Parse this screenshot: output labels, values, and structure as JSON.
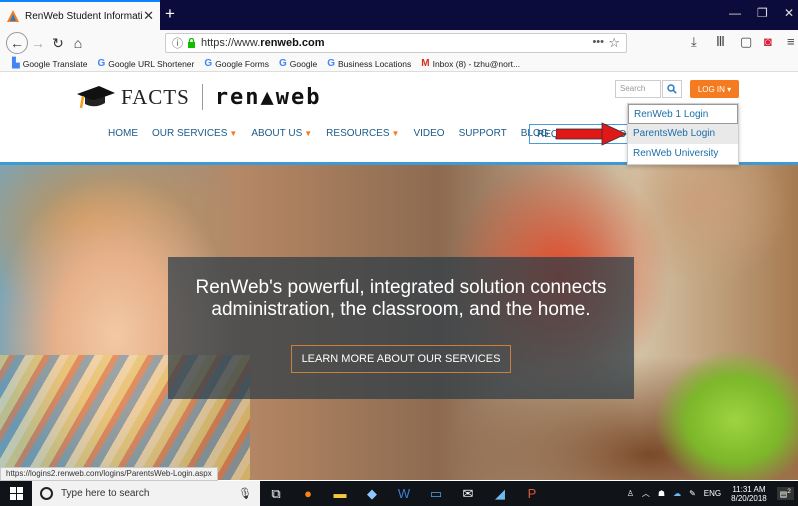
{
  "browser": {
    "tab_title": "RenWeb Student Information S",
    "tab_close": "✕",
    "new_tab": "+",
    "url_prefix": "https://www.",
    "url_domain": "renweb.com",
    "url_more": "•••",
    "window_controls": [
      "—",
      "❐",
      "✕"
    ]
  },
  "bookmarks": [
    {
      "icon": "google-translate-icon",
      "label": "Google Translate"
    },
    {
      "icon": "google-icon",
      "label": "Google URL Shortener"
    },
    {
      "icon": "google-icon",
      "label": "Google Forms"
    },
    {
      "icon": "google-icon",
      "label": "Google"
    },
    {
      "icon": "google-icon",
      "label": "Business Locations"
    },
    {
      "icon": "gmail-icon",
      "label": "Inbox (8) - tzhu@nort..."
    }
  ],
  "site": {
    "logo_facts": "FACTS",
    "logo_renweb": "ren▲web",
    "search_placeholder": "Search",
    "login_label": "LOG IN ▾",
    "nav": [
      {
        "label": "HOME",
        "caret": false
      },
      {
        "label": "OUR SERVICES",
        "caret": true
      },
      {
        "label": "ABOUT US",
        "caret": true
      },
      {
        "label": "RESOURCES",
        "caret": true
      },
      {
        "label": "VIDEO",
        "caret": false
      },
      {
        "label": "SUPPORT",
        "caret": false
      },
      {
        "label": "BLOG",
        "caret": false
      }
    ],
    "demo_button": "REQUEST A DEMO",
    "login_menu": [
      "RenWeb 1 Login",
      "ParentsWeb Login",
      "RenWeb University"
    ]
  },
  "hero": {
    "headline": "RenWeb's powerful, integrated solution connects administration, the classroom, and the home.",
    "cta": "LEARN MORE ABOUT OUR SERVICES"
  },
  "status_url": "https://logins2.renweb.com/logins/ParentsWeb-Login.aspx",
  "taskbar": {
    "search_placeholder": "Type here to search",
    "language": "ENG",
    "time": "11:31 AM",
    "date": "8/20/2018",
    "notification_count": "2"
  },
  "colors": {
    "accent_orange": "#f47b20",
    "link_blue": "#1b6ea8",
    "nav_blue": "#1b5b8a",
    "divider_blue": "#3c9ad5",
    "arrow_red": "#e01818"
  }
}
